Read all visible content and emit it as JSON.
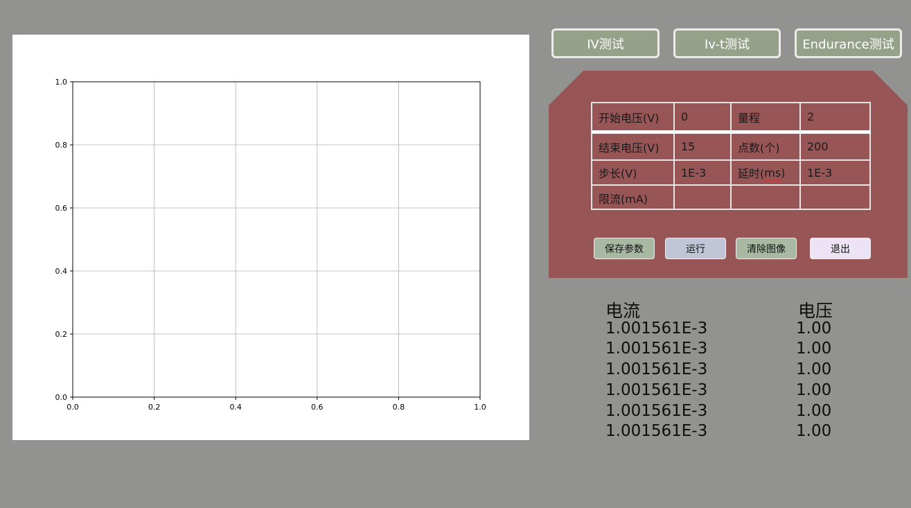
{
  "chart_data": {
    "type": "line",
    "series": [],
    "xlim": [
      0.0,
      1.0
    ],
    "ylim": [
      0.0,
      1.0
    ],
    "xticks": [
      "0.0",
      "0.2",
      "0.4",
      "0.6",
      "0.8",
      "1.0"
    ],
    "yticks": [
      "0.0",
      "0.2",
      "0.4",
      "0.6",
      "0.8",
      "1.0"
    ],
    "grid": true,
    "title": "",
    "xlabel": "",
    "ylabel": ""
  },
  "modes": [
    {
      "label": "IV测试"
    },
    {
      "label": "Iv-t测试"
    },
    {
      "label": "Endurance测试"
    }
  ],
  "params": {
    "start_voltage_label": "开始电压(V)",
    "start_voltage_value": "0",
    "range_label": "量程",
    "range_value": "2",
    "end_voltage_label": "结束电压(V)",
    "end_voltage_value": "15",
    "points_label": "点数(个)",
    "points_value": "200",
    "step_label": "步长(V)",
    "step_value": "1E-3",
    "delay_label_prefix": "延时(",
    "delay_label_unit": "ms",
    "delay_label_suffix": ")",
    "delay_value": "1E-3",
    "current_limit_label": "限流(mA)",
    "current_limit_value": "",
    "empty_a": "",
    "empty_b": ""
  },
  "actions": {
    "save_label": "保存参数",
    "run_label": "运行",
    "clear_label": "清除图像",
    "exit_label": "退出"
  },
  "colors": {
    "save_bg": "#a9b8a2",
    "run_bg": "#c0c6d6",
    "clear_bg": "#a9b8a2",
    "exit_bg": "#ece3f4"
  },
  "readout": {
    "current_header": "电流",
    "voltage_header": "电压",
    "rows": [
      {
        "current": "1.001561E-3",
        "voltage": "1.00"
      },
      {
        "current": "1.001561E-3",
        "voltage": "1.00"
      },
      {
        "current": "1.001561E-3",
        "voltage": "1.00"
      },
      {
        "current": "1.001561E-3",
        "voltage": "1.00"
      },
      {
        "current": "1.001561E-3",
        "voltage": "1.00"
      },
      {
        "current": "1.001561E-3",
        "voltage": "1.00"
      }
    ]
  }
}
